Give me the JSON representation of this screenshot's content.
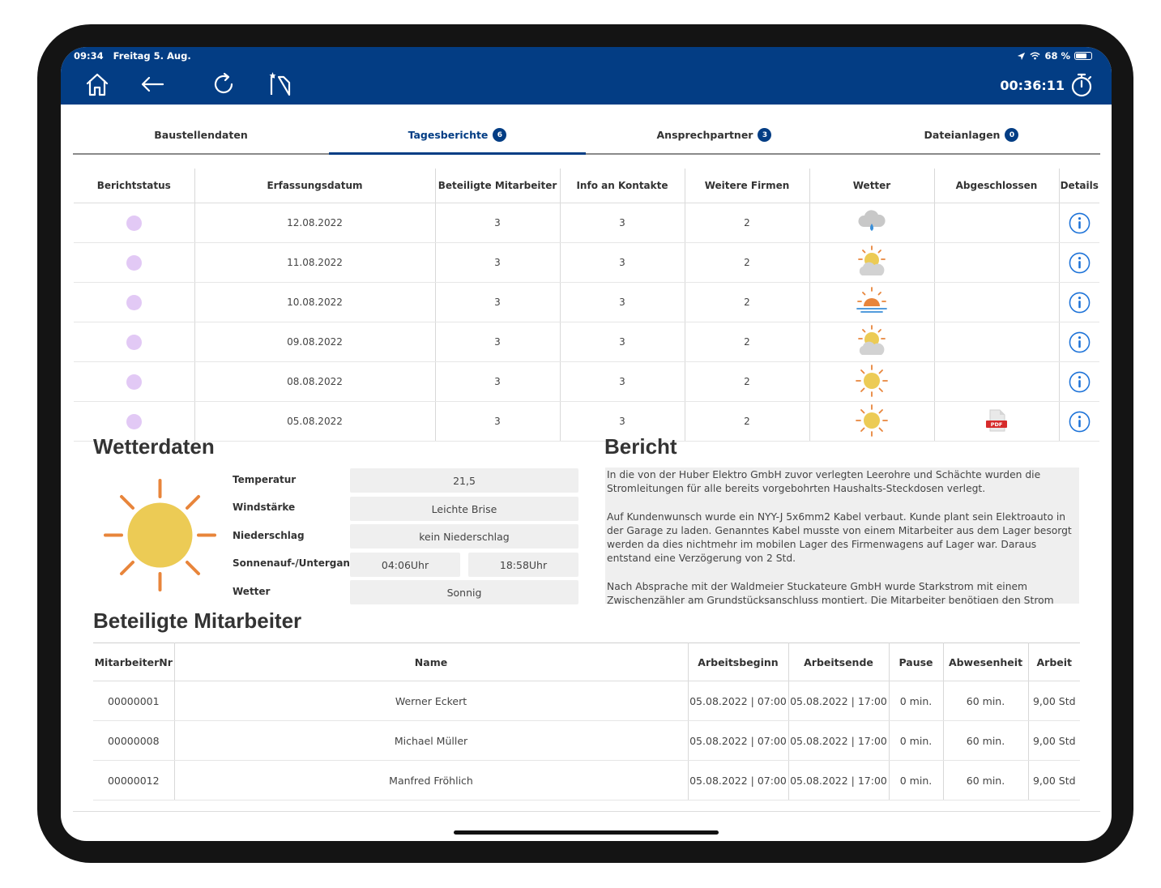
{
  "statusbar": {
    "time": "09:34",
    "date": "Freitag 5. Aug.",
    "battery": "68 %"
  },
  "toolbar": {
    "timer": "00:36:11"
  },
  "tabs": [
    {
      "label": "Baustellendaten",
      "badge": ""
    },
    {
      "label": "Tagesberichte",
      "badge": "6"
    },
    {
      "label": "Ansprechpartner",
      "badge": "3"
    },
    {
      "label": "Dateianlagen",
      "badge": "0"
    }
  ],
  "reports": {
    "headers": [
      "Berichtstatus",
      "Erfassungsdatum",
      "Beteiligte Mitarbeiter",
      "Info an Kontakte",
      "Weitere Firmen",
      "Wetter",
      "Abgeschlossen",
      "Details"
    ],
    "rows": [
      {
        "date": "12.08.2022",
        "employees": "3",
        "contacts": "3",
        "firms": "2",
        "weather_icon": "rain-cloud-icon",
        "closed_icon": ""
      },
      {
        "date": "11.08.2022",
        "employees": "3",
        "contacts": "3",
        "firms": "2",
        "weather_icon": "partly-cloudy-icon",
        "closed_icon": ""
      },
      {
        "date": "10.08.2022",
        "employees": "3",
        "contacts": "3",
        "firms": "2",
        "weather_icon": "sunset-icon",
        "closed_icon": ""
      },
      {
        "date": "09.08.2022",
        "employees": "3",
        "contacts": "3",
        "firms": "2",
        "weather_icon": "partly-cloudy-icon",
        "closed_icon": ""
      },
      {
        "date": "08.08.2022",
        "employees": "3",
        "contacts": "3",
        "firms": "2",
        "weather_icon": "sun-icon",
        "closed_icon": ""
      },
      {
        "date": "05.08.2022",
        "employees": "3",
        "contacts": "3",
        "firms": "2",
        "weather_icon": "sun-icon",
        "closed_icon": "pdf-icon",
        "pdf_label": "PDF"
      }
    ]
  },
  "weather": {
    "title": "Wetterdaten",
    "labels": {
      "temperature": "Temperatur",
      "wind": "Windstärke",
      "precipitation": "Niederschlag",
      "sun": "Sonnenauf-/Untergang",
      "weather": "Wetter"
    },
    "values": {
      "temperature": "21,5",
      "wind": "Leichte Brise",
      "precipitation": "kein Niederschlag",
      "sunrise": "04:06Uhr",
      "sunset": "18:58Uhr",
      "weather": "Sonnig"
    }
  },
  "report": {
    "title": "Bericht",
    "paragraphs": [
      "In die von der Huber Elektro GmbH zuvor verlegten Leerohre und Schächte wurden die Stromleitungen für alle bereits vorgebohrten Haushalts-Steckdosen verlegt.",
      "Auf Kundenwunsch wurde ein NYY-J 5x6mm2 Kabel verbaut. Kunde plant sein Elektroauto in der Garage zu laden. Genanntes Kabel musste von einem Mitarbeiter aus dem Lager besorgt werden da dies nichtmehr im mobilen Lager des Firmenwagens auf Lager war. Daraus entstand eine Verzögerung von 2 Std.",
      "Nach Absprache mit der Waldmeier Stuckateure GmbH wurde Starkstrom mit einem Zwischenzähler am Grundstücksanschluss montiert. Die Mitarbeiter benötigen den Strom zum Betreiben ihrer"
    ]
  },
  "workers": {
    "title": "Beteiligte Mitarbeiter",
    "headers": [
      "MitarbeiterNr",
      "Name",
      "Arbeitsbeginn",
      "Arbeitsende",
      "Pause",
      "Abwesenheit",
      "Arbeit"
    ],
    "rows": [
      [
        "00000001",
        "Werner Eckert",
        "05.08.2022 | 07:00",
        "05.08.2022 | 17:00",
        "0 min.",
        "60 min.",
        "9,00 Std"
      ],
      [
        "00000008",
        "Michael Müller",
        "05.08.2022 | 07:00",
        "05.08.2022 | 17:00",
        "0 min.",
        "60 min.",
        "9,00 Std"
      ],
      [
        "00000012",
        "Manfred Fröhlich",
        "05.08.2022 | 07:00",
        "05.08.2022 | 17:00",
        "0 min.",
        "60 min.",
        "9,00 Std"
      ]
    ]
  },
  "colors": {
    "primary": "#033d84",
    "status_dot": "#e2c9f5",
    "sun": "#eccb55",
    "ray": "#e8853b",
    "cloud": "#cfcfcf",
    "rain": "#3b8fd8",
    "pdf": "#d62b2b"
  }
}
